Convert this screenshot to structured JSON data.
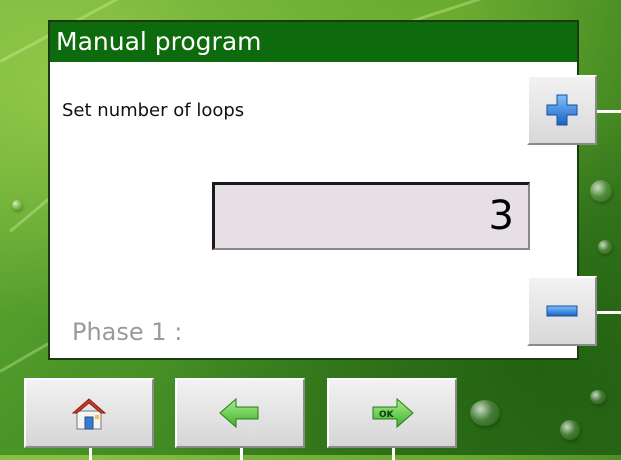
{
  "window": {
    "title": "Manual program"
  },
  "main": {
    "prompt": "Set number of loops",
    "loop_count": "3",
    "phase_label": "Phase 1 :"
  },
  "side_buttons": {
    "increment": "plus-icon",
    "decrement": "minus-icon"
  },
  "bottom_buttons": {
    "home": "home-icon",
    "back": "back-arrow-icon",
    "confirm": "ok-arrow-icon"
  },
  "colors": {
    "title_bar": "#0d6b0d",
    "value_box": "#e6dfe6",
    "plus_icon": "#2c7fd8",
    "minus_icon": "#2c7fd8",
    "back_arrow": "#5ed64a",
    "ok_arrow": "#5ed64a"
  }
}
